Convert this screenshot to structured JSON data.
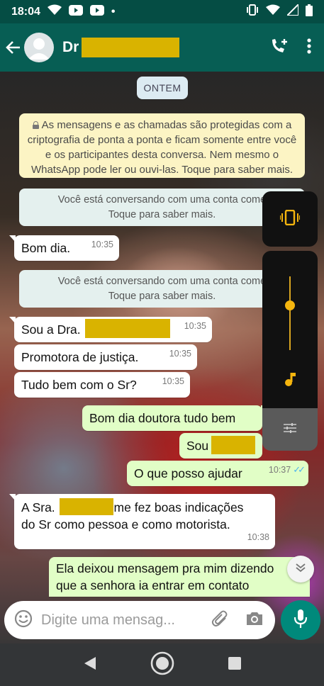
{
  "status_bar": {
    "time": "18:04",
    "dot": "•"
  },
  "header": {
    "contact_name_prefix": "Dr"
  },
  "chat": {
    "date_label": "ONTEM",
    "encryption_notice": "As mensagens e as chamadas são protegidas com a criptografia de ponta a ponta e ficam somente entre você e os participantes desta conversa. Nem mesmo o WhatsApp pode ler ou ouvi-las. Toque para saber mais.",
    "business_notice_1": {
      "line1": "Você está conversando com uma conta come",
      "line2": "Toque para saber mais."
    },
    "business_notice_2": {
      "line1": "Você está conversando com uma conta come",
      "line2": "Toque para saber mais."
    },
    "messages": [
      {
        "text": "Bom dia.",
        "time": "10:35"
      },
      {
        "text_prefix": "Sou a Dra.",
        "time": "10:35"
      },
      {
        "text": "Promotora de justiça.",
        "time": "10:35"
      },
      {
        "text": "Tudo bem com o Sr?",
        "time": "10:35"
      },
      {
        "text": "Bom dia doutora tudo bem"
      },
      {
        "text_prefix": "Sou"
      },
      {
        "text": "O que posso ajudar",
        "time": "10:37",
        "ticks": "✓✓"
      },
      {
        "text_prefix": "A Sra.",
        "text_suffix": "me fez boas indicações",
        "line2": "do Sr como pessoa e como motorista.",
        "time": "10:38"
      },
      {
        "line1": "Ela deixou mensagem pra mim dizendo",
        "line2": "que a senhora ia entrar em contato"
      }
    ]
  },
  "input": {
    "placeholder": "Digite uma mensag..."
  },
  "colors": {
    "header": "#075e54",
    "status_bar": "#054d44",
    "outgoing_bubble": "#e1fec6",
    "system_note": "#fcf4c4",
    "mic_button": "#00897b",
    "volume_accent": "#f5b50e",
    "redaction": "#d9b300"
  },
  "icons": [
    "wifi-icon",
    "youtube-icon",
    "vibrate-icon",
    "signal-icon",
    "battery-icon",
    "back-arrow-icon",
    "avatar-icon",
    "add-call-icon",
    "more-vert-icon",
    "lock-icon",
    "music-note-icon",
    "equalizer-icon",
    "chevron-down-icon",
    "emoji-icon",
    "attach-icon",
    "camera-icon",
    "mic-icon",
    "nav-back-icon",
    "nav-home-icon",
    "nav-recents-icon"
  ]
}
